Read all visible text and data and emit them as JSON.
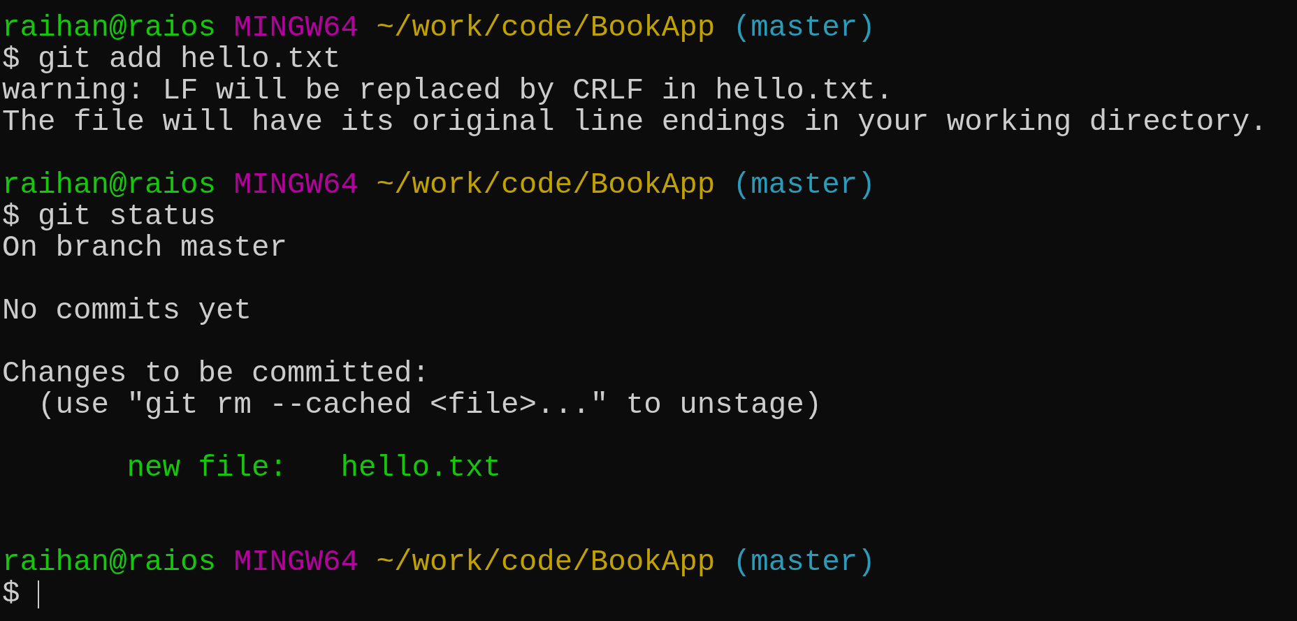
{
  "terminal": {
    "lines": [
      {
        "kind": "prompt",
        "user_host": "raihan@raios",
        "system": "MINGW64",
        "path": "~/work/code/BookApp",
        "branch": "(master)"
      },
      {
        "kind": "command",
        "symbol": "$",
        "command": "git add hello.txt"
      },
      {
        "kind": "text",
        "text": "warning: LF will be replaced by CRLF in hello.txt."
      },
      {
        "kind": "text",
        "text": "The file will have its original line endings in your working directory."
      },
      {
        "kind": "blank"
      },
      {
        "kind": "prompt",
        "user_host": "raihan@raios",
        "system": "MINGW64",
        "path": "~/work/code/BookApp",
        "branch": "(master)"
      },
      {
        "kind": "command",
        "symbol": "$",
        "command": "git status"
      },
      {
        "kind": "text",
        "text": "On branch master"
      },
      {
        "kind": "blank"
      },
      {
        "kind": "text",
        "text": "No commits yet"
      },
      {
        "kind": "blank"
      },
      {
        "kind": "text",
        "text": "Changes to be committed:"
      },
      {
        "kind": "hint",
        "text": "(use \"git rm --cached <file>...\" to unstage)"
      },
      {
        "kind": "blank"
      },
      {
        "kind": "file",
        "status": "new file:",
        "file": "hello.txt"
      },
      {
        "kind": "blank"
      },
      {
        "kind": "blank"
      },
      {
        "kind": "prompt",
        "user_host": "raihan@raios",
        "system": "MINGW64",
        "path": "~/work/code/BookApp",
        "branch": "(master)"
      },
      {
        "kind": "input",
        "symbol": "$"
      }
    ]
  }
}
